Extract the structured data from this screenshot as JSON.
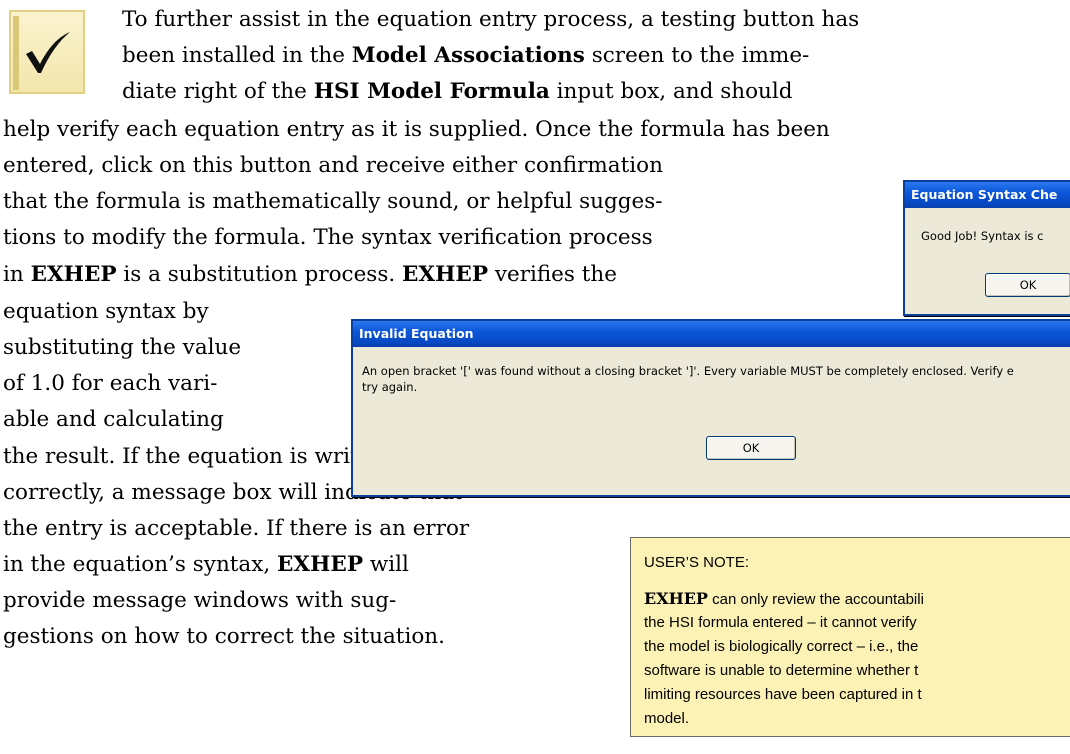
{
  "icon": {
    "name": "checkmark-icon"
  },
  "paragraph": [
    {
      "segments": [
        {
          "text": "To further assist in the equation entry process, a testing button has",
          "bold": false
        }
      ]
    },
    {
      "segments": [
        {
          "text": "been installed in the ",
          "bold": false
        },
        {
          "text": "Model Associations",
          "bold": true
        },
        {
          "text": " screen to the imme-",
          "bold": false
        }
      ]
    },
    {
      "segments": [
        {
          "text": "diate right of the ",
          "bold": false
        },
        {
          "text": "HSI Model Formula",
          "bold": true
        },
        {
          "text": " input box, and should",
          "bold": false
        }
      ]
    },
    {
      "segments": [
        {
          "text": "help verify each equation entry as it is supplied. Once the formula has been",
          "bold": false
        }
      ]
    },
    {
      "segments": [
        {
          "text": "entered, click on this button and receive either confirmation",
          "bold": false
        }
      ]
    },
    {
      "segments": [
        {
          "text": "that the formula is mathematically sound, or helpful sugges-",
          "bold": false
        }
      ]
    },
    {
      "segments": [
        {
          "text": "tions to modify the formula. The syntax verification process",
          "bold": false
        }
      ]
    },
    {
      "segments": [
        {
          "text": "in ",
          "bold": false
        },
        {
          "text": "EXHEP",
          "bold": true
        },
        {
          "text": " is a substitution process. ",
          "bold": false
        },
        {
          "text": "EXHEP",
          "bold": true
        },
        {
          "text": " verifies the",
          "bold": false
        }
      ]
    },
    {
      "segments": [
        {
          "text": "equation syntax by",
          "bold": false
        }
      ]
    },
    {
      "segments": [
        {
          "text": "substituting the value",
          "bold": false
        }
      ]
    },
    {
      "segments": [
        {
          "text": "of 1.0 for each vari-",
          "bold": false
        }
      ]
    },
    {
      "segments": [
        {
          "text": "able and calculating",
          "bold": false
        }
      ]
    },
    {
      "segments": [
        {
          "text": "the result. If the equation is written",
          "bold": false
        }
      ]
    },
    {
      "segments": [
        {
          "text": "correctly, a message box will indicate that",
          "bold": false
        }
      ]
    },
    {
      "segments": [
        {
          "text": "the entry is acceptable. If there is an error",
          "bold": false
        }
      ]
    },
    {
      "segments": [
        {
          "text": "in the equation’s syntax, ",
          "bold": false
        },
        {
          "text": "EXHEP",
          "bold": true
        },
        {
          "text": " will",
          "bold": false
        }
      ]
    },
    {
      "segments": [
        {
          "text": "provide message windows with sug-",
          "bold": false
        }
      ]
    },
    {
      "segments": [
        {
          "text": "gestions on how to correct the situation.",
          "bold": false
        }
      ]
    }
  ],
  "syntax_dialog": {
    "title": "Equation Syntax Che",
    "message": "Good Job!  Syntax is c",
    "ok_label": "OK"
  },
  "invalid_dialog": {
    "title": "Invalid Equation",
    "message_line1": "An open bracket '[' was found without a closing bracket ']'. Every variable MUST be completely enclosed. Verify e",
    "message_line2": "try again.",
    "ok_label": "OK"
  },
  "note": {
    "title": "USER’S NOTE:",
    "lines": [
      {
        "segments": [
          {
            "text": "EXHEP",
            "bold": true
          },
          {
            "text": " can only review the accountabili",
            "bold": false
          }
        ]
      },
      {
        "segments": [
          {
            "text": "the HSI formula entered – it cannot verify",
            "bold": false
          }
        ]
      },
      {
        "segments": [
          {
            "text": "the model is biologically correct – i.e., the",
            "bold": false
          }
        ]
      },
      {
        "segments": [
          {
            "text": "software is unable to determine whether t",
            "bold": false
          }
        ]
      },
      {
        "segments": [
          {
            "text": "limiting resources have been captured in t",
            "bold": false
          }
        ]
      },
      {
        "segments": [
          {
            "text": "model.",
            "bold": false
          }
        ]
      }
    ]
  }
}
